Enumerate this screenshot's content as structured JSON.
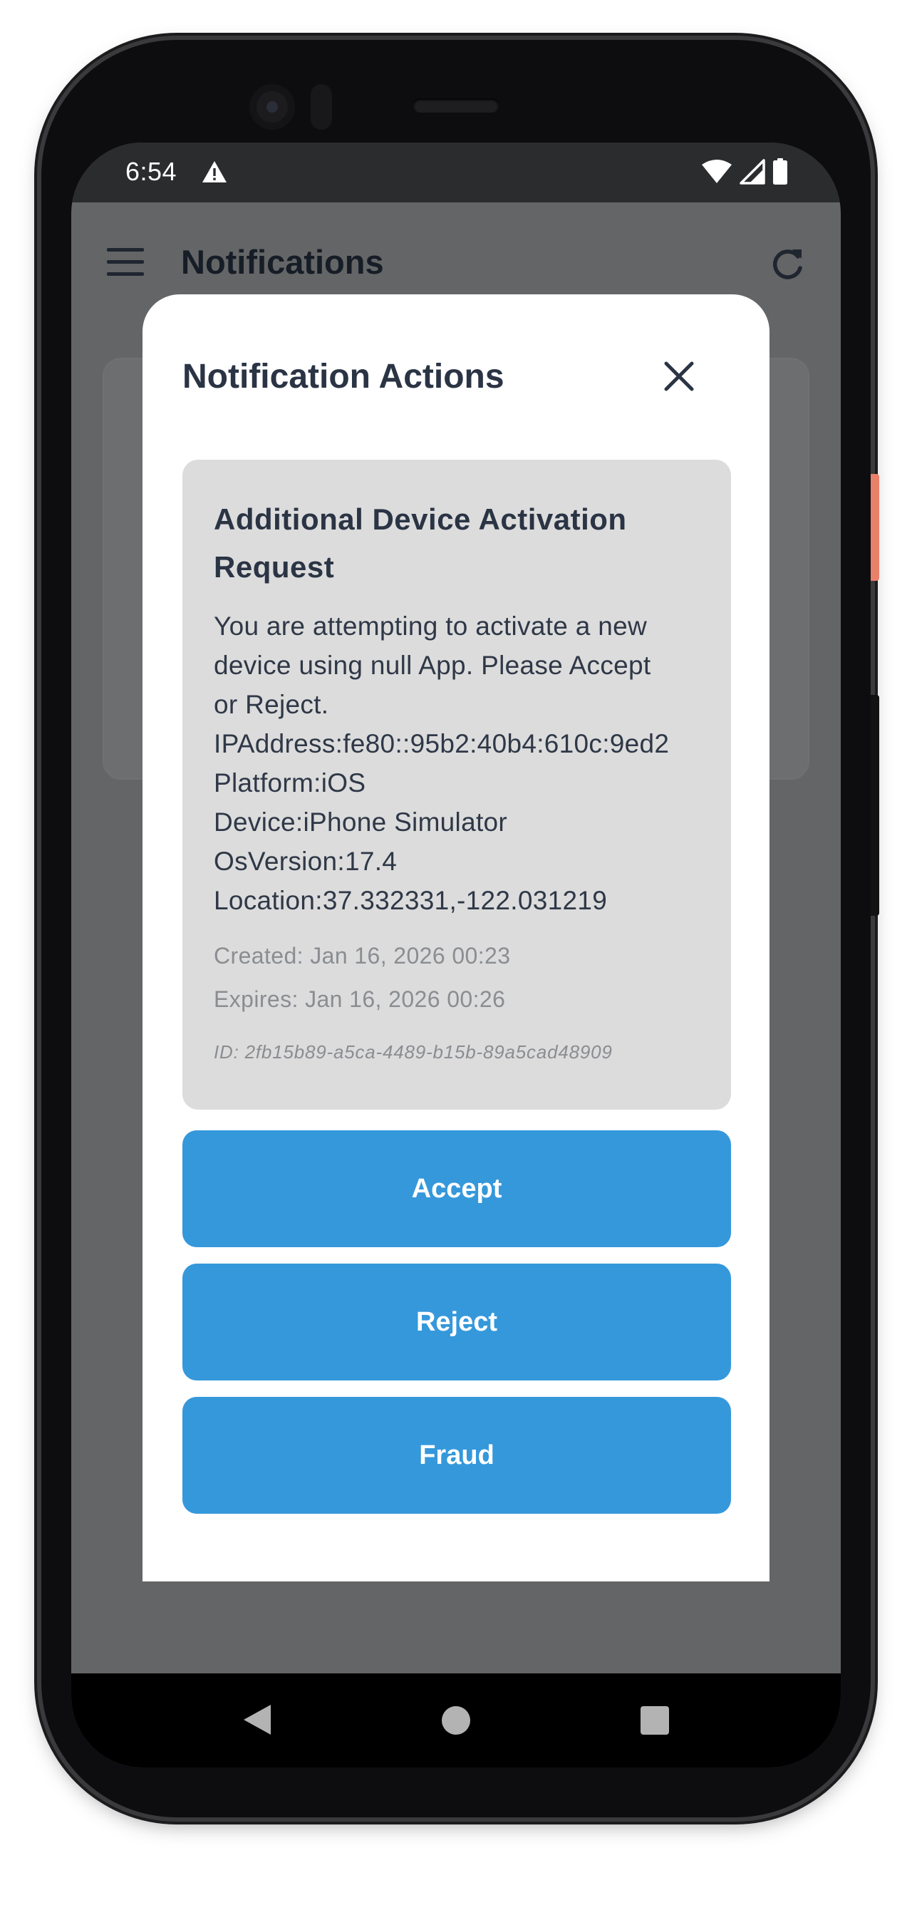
{
  "status_bar": {
    "time": "6:54",
    "icons": [
      "warning-icon",
      "wifi-icon",
      "cellular-signal-icon",
      "battery-icon"
    ]
  },
  "app_bar": {
    "title": "Notifications",
    "menu_icon": "menu-icon",
    "refresh_icon": "refresh-icon"
  },
  "modal": {
    "title": "Notification Actions",
    "close_icon": "close-icon",
    "notification": {
      "title": "Additional Device Activation Request",
      "body_lines": [
        "You are attempting to activate a new",
        "device using null App. Please Accept",
        "or Reject.",
        "IPAddress:fe80::95b2:40b4:610c:9ed2",
        "Platform:iOS",
        "Device:iPhone Simulator",
        "OsVersion:17.4",
        "Location:37.332331,-122.031219"
      ],
      "created": "Created: Jan 16, 2026 00:23",
      "expires": "Expires: Jan 16, 2026 00:26",
      "id": "ID: 2fb15b89-a5ca-4489-b15b-89a5cad48909"
    },
    "buttons": {
      "accept": "Accept",
      "reject": "Reject",
      "fraud": "Fraud"
    }
  },
  "colors": {
    "primary_button": "#3598db",
    "overlay": "#646566",
    "card_bg": "#dcdcdc",
    "title_text": "#2a3444"
  }
}
